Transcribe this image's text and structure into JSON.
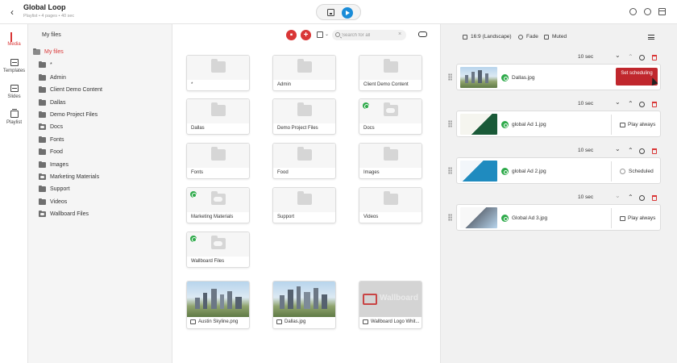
{
  "header": {
    "title": "Global Loop",
    "subtitle": "Playlist • 4 pages • 40 sec"
  },
  "nav": [
    {
      "label": "Media"
    },
    {
      "label": "Templates"
    },
    {
      "label": "Slides"
    },
    {
      "label": "Playlist"
    }
  ],
  "tree": {
    "heading": "My files",
    "root": "My files",
    "items": [
      {
        "label": "*"
      },
      {
        "label": "Admin"
      },
      {
        "label": "Client Demo Content"
      },
      {
        "label": "Dallas"
      },
      {
        "label": "Demo Project Files"
      },
      {
        "label": "Docs"
      },
      {
        "label": "Fonts"
      },
      {
        "label": "Food"
      },
      {
        "label": "Images"
      },
      {
        "label": "Marketing Materials"
      },
      {
        "label": "Support"
      },
      {
        "label": "Videos"
      },
      {
        "label": "Wallboard Files"
      }
    ]
  },
  "files": {
    "search_placeholder": "Search for all",
    "folders": [
      {
        "label": "*"
      },
      {
        "label": "Admin"
      },
      {
        "label": "Client Demo Content"
      },
      {
        "label": "Dallas"
      },
      {
        "label": "Demo Project Files"
      },
      {
        "label": "Docs"
      },
      {
        "label": "Fonts"
      },
      {
        "label": "Food"
      },
      {
        "label": "Images"
      },
      {
        "label": "Marketing Materials"
      },
      {
        "label": "Support"
      },
      {
        "label": "Videos"
      },
      {
        "label": "Wallboard Files"
      }
    ],
    "images": [
      {
        "label": "Austin Skyline.png"
      },
      {
        "label": "Dallas.jpg"
      },
      {
        "label": "Wallboard Logo Whit..."
      }
    ],
    "wallboard_text": "Wallboard"
  },
  "playlist": {
    "aspect": "16:9 (Landscape)",
    "transition": "Fade",
    "audio": "Muted",
    "items": [
      {
        "duration": "10 sec",
        "name": "Dallas.jpg",
        "status": "Set scheduling"
      },
      {
        "duration": "10 sec",
        "name": "global Ad 1.jpg",
        "status": "Play always"
      },
      {
        "duration": "10 sec",
        "name": "global Ad 2.jpg",
        "status": "Scheduled"
      },
      {
        "duration": "10 sec",
        "name": "Global Ad 3.jpg",
        "status": "Play always"
      }
    ]
  },
  "colors": {
    "accent": "#d93636",
    "primary_blue": "#1a8cd8",
    "status_green": "#2eaa4a",
    "schedule_red": "#c0272d"
  }
}
